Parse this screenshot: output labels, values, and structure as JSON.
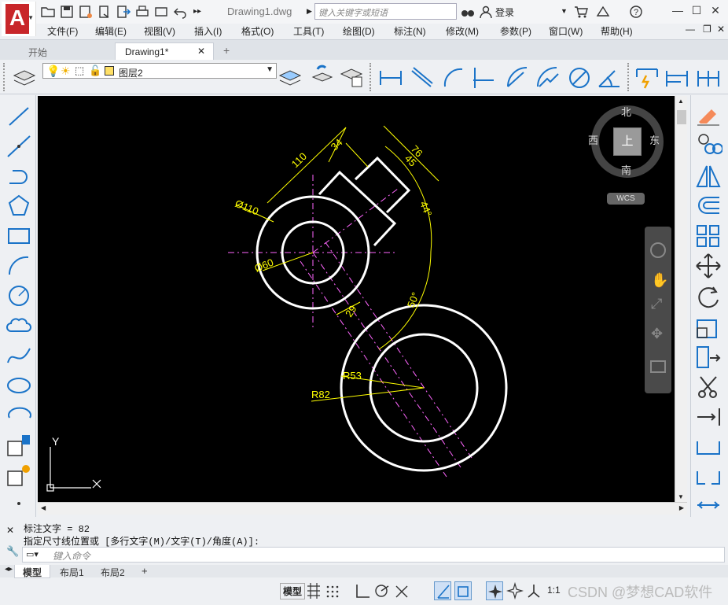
{
  "app": {
    "doc_title": "Drawing1.dwg",
    "search_placeholder": "键入关键字或短语",
    "login_label": "登录"
  },
  "menu": [
    "文件(F)",
    "编辑(E)",
    "视图(V)",
    "插入(I)",
    "格式(O)",
    "工具(T)",
    "绘图(D)",
    "标注(N)",
    "修改(M)",
    "参数(P)",
    "窗口(W)",
    "帮助(H)"
  ],
  "file_tabs": [
    {
      "label": "开始"
    },
    {
      "label": "Drawing1*"
    },
    {
      "label": "+"
    }
  ],
  "layer": {
    "current": "图层2",
    "color": "#ffe066"
  },
  "viewcube": {
    "top_label": "上",
    "north": "北",
    "south": "南",
    "east": "东",
    "west": "西",
    "ucs": "WCS"
  },
  "drawing": {
    "dimensions": {
      "d110_len": "110",
      "d34": "34",
      "d76": "76",
      "d45": "45",
      "diam110": "Ø110",
      "diam60": "Ø60",
      "angle44": "44°",
      "angle50": "50°",
      "d29": "29",
      "r53": "R53",
      "r82": "R82"
    },
    "axis_y": "Y",
    "colors": {
      "geometry": "#ffffff",
      "dims": "#ffff00",
      "center": "#ff66ff"
    }
  },
  "command": {
    "line1": "标注文字 = 82",
    "line2": "指定尺寸线位置或 [多行文字(M)/文字(T)/角度(A)]:",
    "placeholder": "键入命令"
  },
  "layouts": [
    {
      "label": "模型"
    },
    {
      "label": "布局1"
    },
    {
      "label": "布局2"
    },
    {
      "label": "+"
    }
  ],
  "status": {
    "model": "模型",
    "scale": "1:1",
    "watermark": "CSDN @梦想CAD软件"
  }
}
